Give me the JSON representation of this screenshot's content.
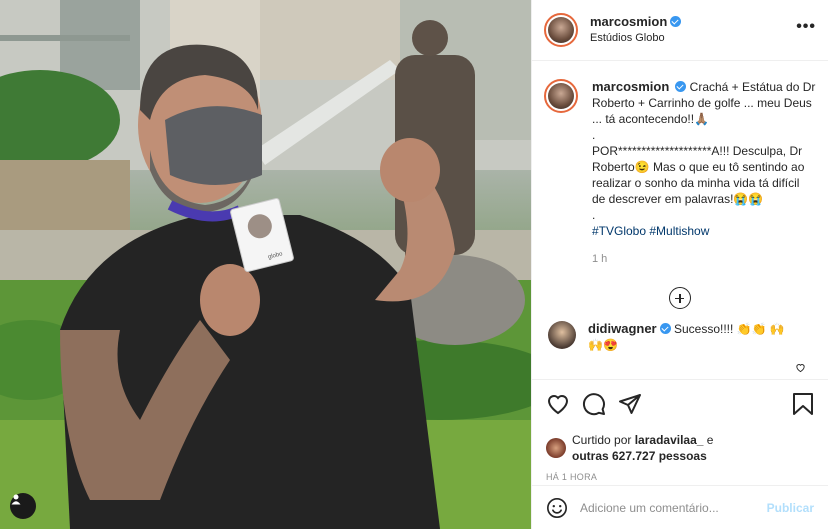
{
  "post": {
    "username": "marcosmion",
    "location": "Estúdios Globo",
    "more_icon": "more-horizontal-icon",
    "verified_icon": "verified-badge-icon"
  },
  "caption": {
    "username": "marcosmion",
    "line1": "Crachá + Estátua do Dr Roberto + Carrinho de golfe ... meu Deus ... tá acontecendo!!🙏🏽",
    "dot1": ".",
    "line2": "POR********************A!!! Desculpa, Dr Roberto😉 Mas o que eu tô sentindo ao realizar o sonho da minha vida tá difícil de descrever em palavras!😭😭",
    "dot2": ".",
    "hashtags": "#TVGlobo #Multishow",
    "ago": "1 h"
  },
  "comments": [
    {
      "username": "didiwagner",
      "text": "Sucesso!!!! 👏👏 🙌🙌😍"
    }
  ],
  "actions": {
    "like_icon": "heart-icon",
    "comment_icon": "comment-icon",
    "share_icon": "share-icon",
    "save_icon": "bookmark-icon"
  },
  "likes": {
    "prefix": "Curtido por",
    "user": "laradavilaa_",
    "middle": "e",
    "others": "outras 627.727 pessoas"
  },
  "timestamp": "HÁ 1 HORA",
  "add_comment": {
    "placeholder": "Adicione um comentário...",
    "publish_label": "Publicar",
    "emoji_icon": "emoji-icon"
  },
  "photo": {
    "tag_icon": "user-tag-icon",
    "badge_text": "globo"
  },
  "colors": {
    "accent": "#0095f6",
    "publish_disabled": "#b2dffc",
    "verified": "#3897f0",
    "hashtag": "#00376b"
  }
}
